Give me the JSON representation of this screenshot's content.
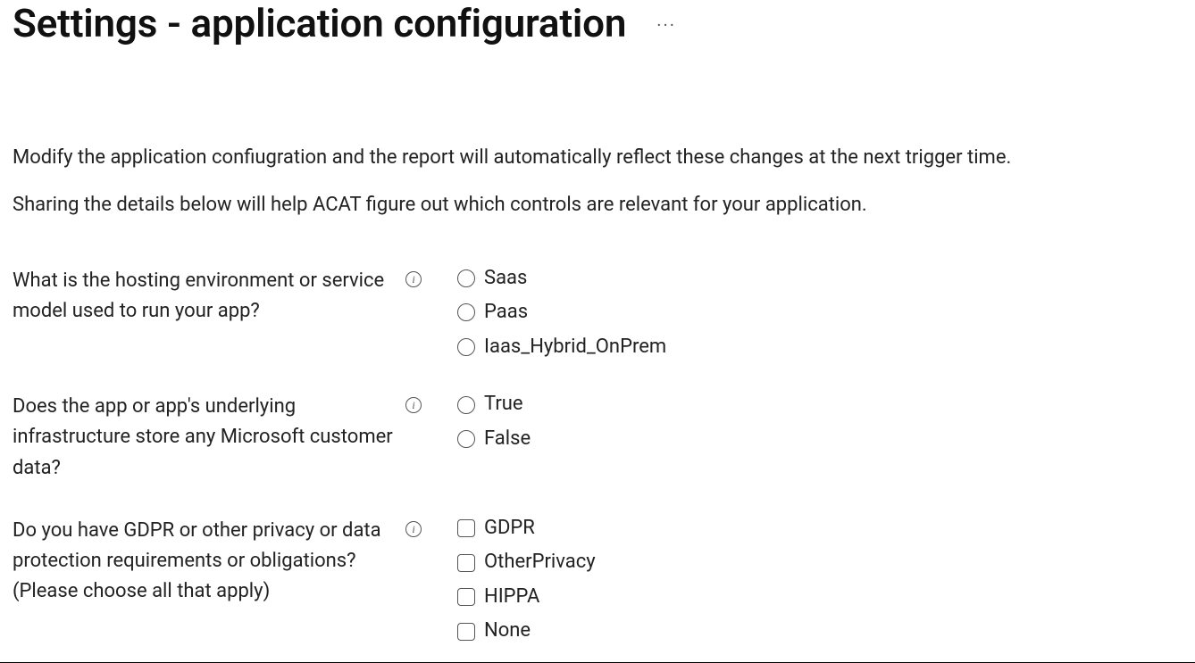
{
  "header": {
    "title": "Settings - application configuration",
    "more_label": "···"
  },
  "intro": {
    "line1": "Modify the application confiugration and the report will automatically reflect these changes at the next trigger time.",
    "line2": "Sharing the details below will help ACAT figure out which controls are relevant for your application."
  },
  "questions": {
    "q1": {
      "label": "What is the hosting environment or service model used to run your app?",
      "options": [
        "Saas",
        "Paas",
        "Iaas_Hybrid_OnPrem"
      ]
    },
    "q2": {
      "label": "Does the app or app's underlying infrastructure store any Microsoft customer data?",
      "options": [
        "True",
        "False"
      ]
    },
    "q3": {
      "label": "Do you have GDPR or other privacy or data protection requirements or obligations? (Please choose all that apply)",
      "options": [
        "GDPR",
        "OtherPrivacy",
        "HIPPA",
        "None"
      ]
    }
  },
  "icons": {
    "info_glyph": "i"
  }
}
